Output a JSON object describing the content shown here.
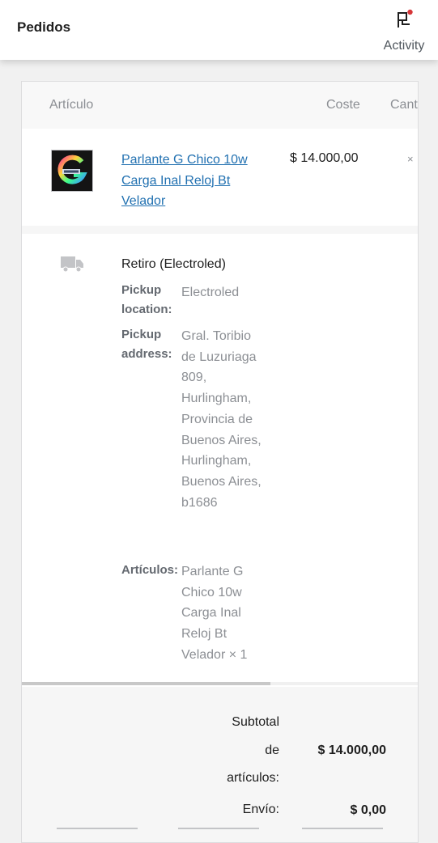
{
  "header": {
    "title": "Pedidos",
    "activity_label": "Activity"
  },
  "table": {
    "columns": [
      "Artículo",
      "Coste",
      "Cant"
    ],
    "item": {
      "name": "Parlante G Chico 10w Carga Inal Reloj Bt Velador",
      "cost": "$ 14.000,00",
      "qty_prefix": "×"
    }
  },
  "shipping": {
    "title": "Retiro (Electroled)",
    "pickup_location_label": "Pickup location:",
    "pickup_location": "Electroled",
    "pickup_address_label": "Pickup address:",
    "pickup_address": "Gral. Toribio de Luzuriaga 809, Hurlingham, Provincia de Buenos Aires, Hurlingham, Buenos Aires, b1686",
    "items_label": "Artículos:",
    "items": "Parlante G Chico 10w Carga Inal Reloj Bt Velador × 1"
  },
  "totals": {
    "subtotal_label": "Subtotal de artículos:",
    "subtotal": "$ 14.000,00",
    "shipping_label": "Envío:",
    "shipping": "$ 0,00"
  },
  "colors": {
    "link": "#2271b1",
    "accent_dot": "#d63638"
  }
}
